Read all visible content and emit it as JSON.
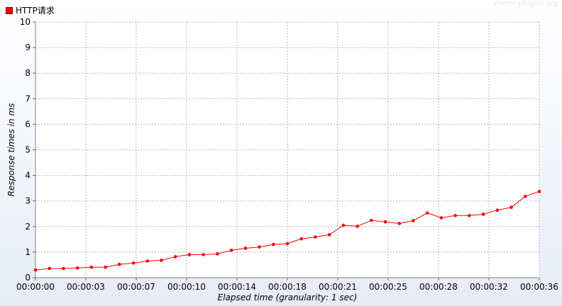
{
  "legend": {
    "label": "HTTP请求",
    "color": "#ff0000"
  },
  "watermark": "jmeter-plugins.org",
  "chart_data": {
    "type": "line",
    "title": "",
    "xlabel": "Elapsed time (granularity: 1 sec)",
    "ylabel": "Response times in ms",
    "ylim": [
      0,
      10
    ],
    "y_ticks": [
      "0",
      "1",
      "2",
      "3",
      "4",
      "5",
      "6",
      "7",
      "8",
      "9",
      "10"
    ],
    "x_ticks": [
      "00:00:00",
      "00:00:03",
      "00:00:07",
      "00:00:10",
      "00:00:14",
      "00:00:18",
      "00:00:21",
      "00:00:25",
      "00:00:28",
      "00:00:32",
      "00:00:36"
    ],
    "x_tick_seconds": [
      0,
      3.6,
      7.2,
      10.8,
      14.4,
      18.0,
      21.6,
      25.2,
      28.8,
      32.4,
      36.0
    ],
    "xlim_seconds": [
      0,
      36
    ],
    "grid": true,
    "legend_position": "top-left",
    "series": [
      {
        "name": "HTTP请求",
        "color": "#ff0000",
        "x_seconds": [
          0,
          1,
          2,
          3,
          4,
          5,
          6,
          7,
          8,
          9,
          10,
          11,
          12,
          13,
          14,
          15,
          16,
          17,
          18,
          19,
          20,
          21,
          22,
          23,
          24,
          25,
          26,
          27,
          28,
          29,
          30,
          31,
          32,
          33,
          34,
          35,
          36
        ],
        "values": [
          0.3,
          0.36,
          0.36,
          0.38,
          0.41,
          0.41,
          0.52,
          0.57,
          0.65,
          0.68,
          0.82,
          0.9,
          0.9,
          0.93,
          1.07,
          1.15,
          1.2,
          1.3,
          1.33,
          1.52,
          1.59,
          1.68,
          2.05,
          2.01,
          2.24,
          2.18,
          2.12,
          2.23,
          2.53,
          2.34,
          2.43,
          2.43,
          2.48,
          2.64,
          2.75,
          3.18,
          3.37
        ]
      }
    ]
  }
}
